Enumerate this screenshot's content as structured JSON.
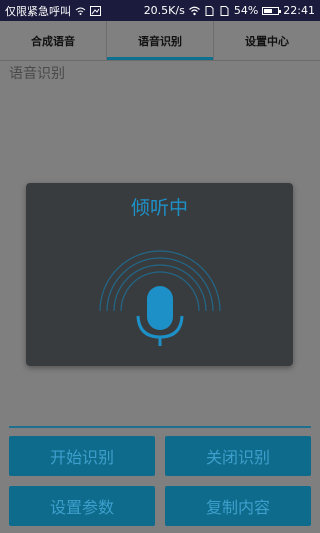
{
  "status_bar": {
    "carrier": "仅限紧急呼叫",
    "speed": "20.5K/s",
    "battery": "54%",
    "time": "22:41"
  },
  "tabs": [
    {
      "label": "合成语音"
    },
    {
      "label": "语音识别"
    },
    {
      "label": "设置中心"
    }
  ],
  "active_tab": "语音识别",
  "section_title": "语音识别",
  "dialog": {
    "title": "倾听中",
    "icon": "microphone-icon"
  },
  "buttons": {
    "start": "开始识别",
    "close": "关闭识别",
    "settings": "设置参数",
    "copy": "复制内容"
  },
  "colors": {
    "accent": "#1e90c8",
    "button_bg": "#0f6b8c",
    "button_text": "#3d9fcc",
    "dialog_bg": "#393c3e",
    "status_bar_bg": "#1b1b3d"
  }
}
